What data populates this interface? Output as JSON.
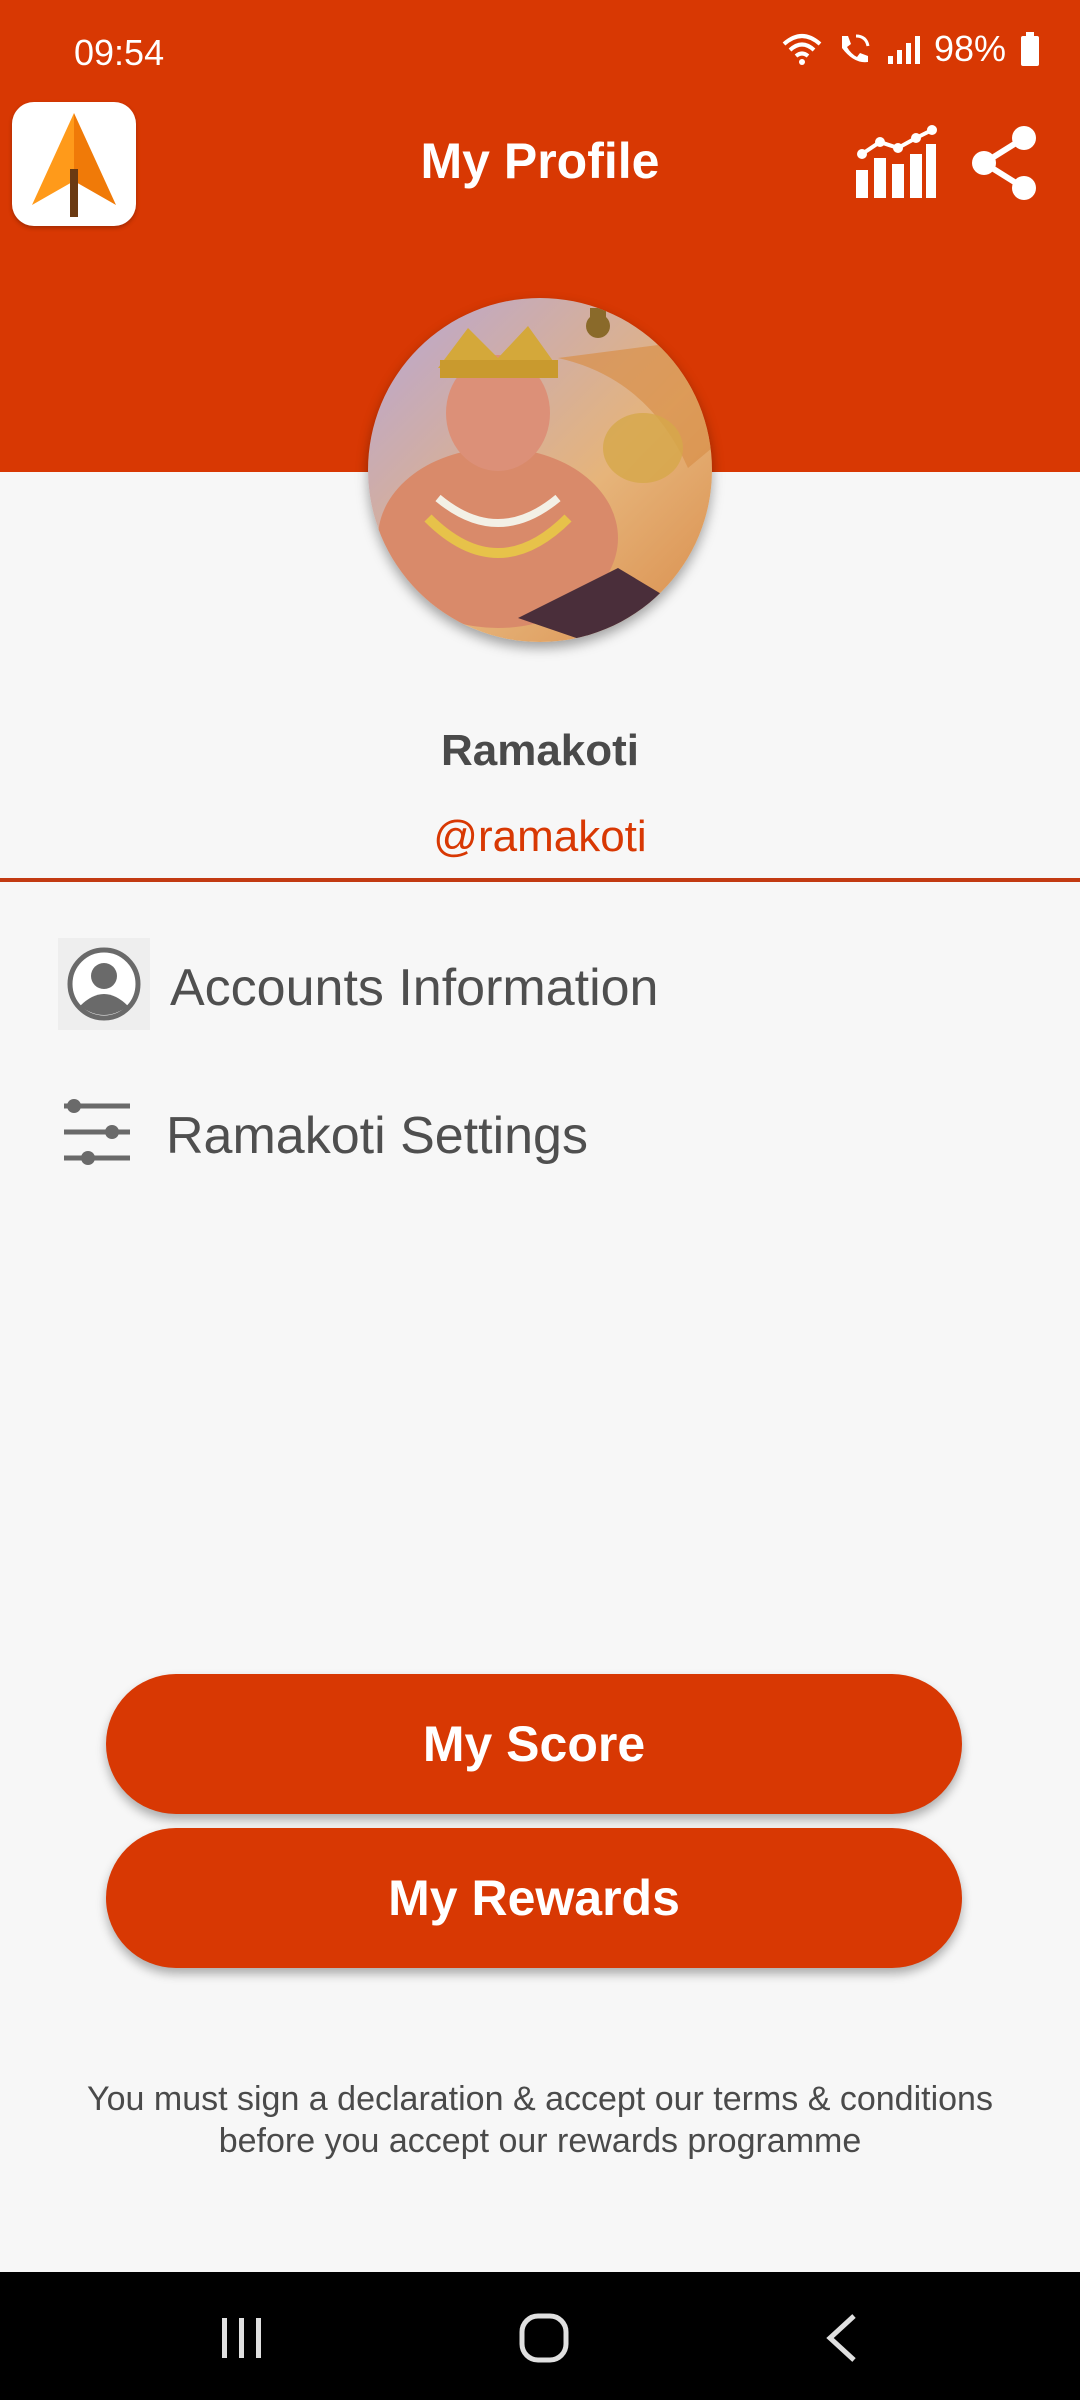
{
  "status_bar": {
    "time": "09:54",
    "battery": "98%",
    "icons": [
      "wifi-icon",
      "wifi-calling-icon",
      "signal-icon",
      "battery-icon"
    ]
  },
  "header": {
    "title": "My Profile",
    "logo_icon": "arrow-logo-icon",
    "actions": [
      "stats-chart-icon",
      "share-icon"
    ],
    "color": "#d83803"
  },
  "profile": {
    "name": "Ramakoti",
    "handle": "@ramakoti"
  },
  "menu": {
    "items": [
      {
        "label": "Accounts Information",
        "icon": "account-icon"
      },
      {
        "label": "Ramakoti Settings",
        "icon": "settings-sliders-icon"
      }
    ]
  },
  "buttons": {
    "score": "My Score",
    "rewards": "My Rewards"
  },
  "disclaimer": {
    "line1": "You must sign a declaration & accept our terms & conditions",
    "line2": "before you accept our rewards programme"
  },
  "nav": {
    "icons": [
      "recents-icon",
      "home-icon",
      "back-icon"
    ]
  }
}
